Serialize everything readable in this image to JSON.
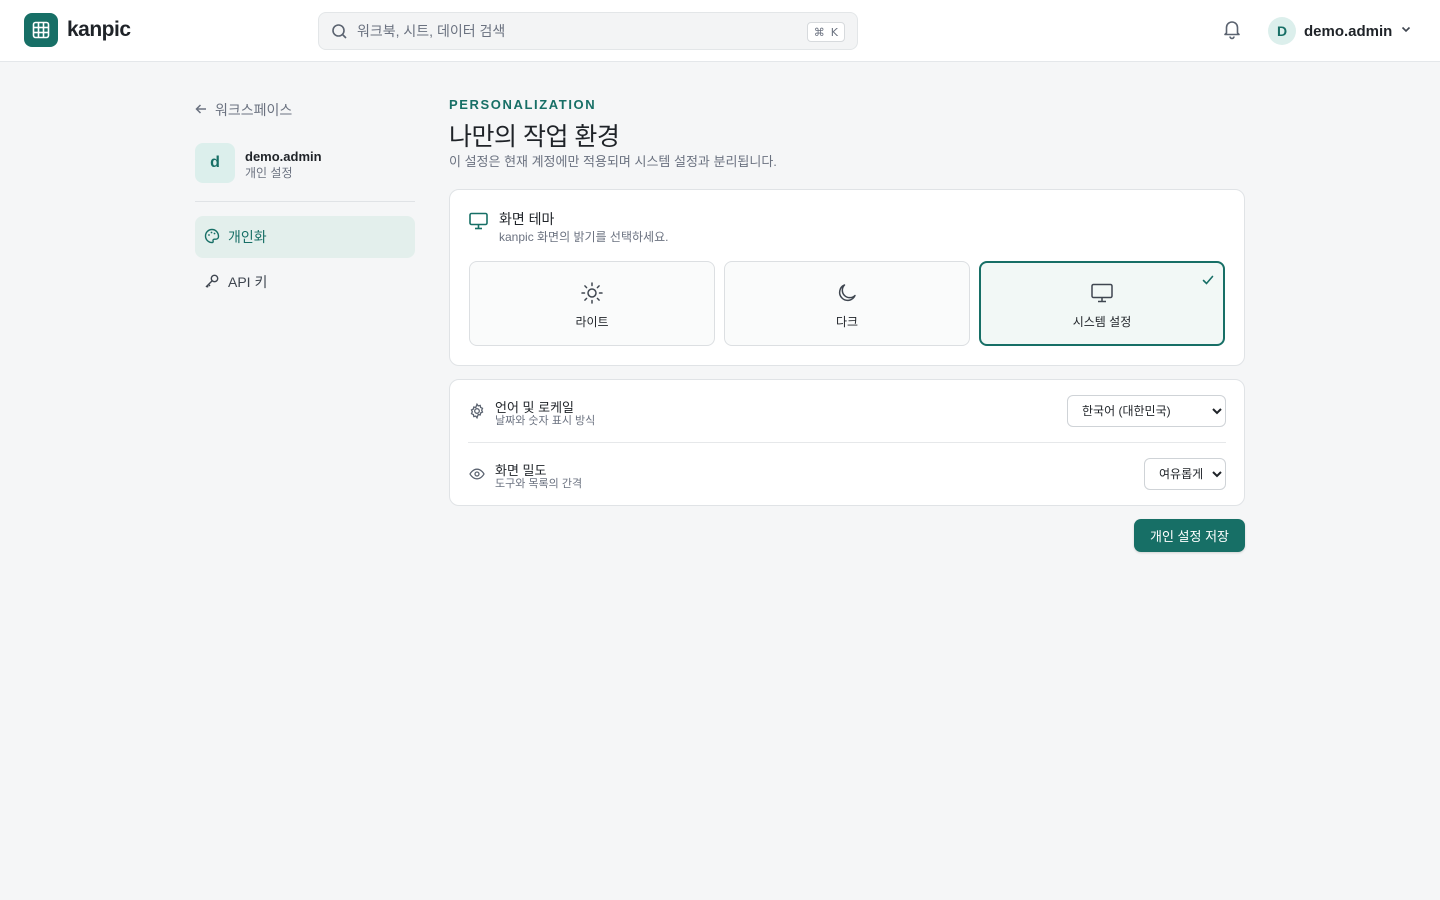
{
  "header": {
    "logo_text": "kanpic",
    "search_placeholder": "워크북, 시트, 데이터 검색",
    "shortcut_symbol": "⌘",
    "shortcut_key": "K",
    "user_initial": "D",
    "user_name": "demo.admin"
  },
  "sidebar": {
    "back_label": "워크스페이스",
    "profile_initial": "d",
    "profile_name": "demo.admin",
    "profile_subtitle": "개인 설정",
    "items": [
      {
        "label": "개인화",
        "icon": "palette-icon",
        "active": true
      },
      {
        "label": "API 키",
        "icon": "key-icon",
        "active": false
      }
    ]
  },
  "main": {
    "eyebrow": "PERSONALIZATION",
    "title": "나만의 작업 환경",
    "description": "이 설정은 현재 계정에만 적용되며 시스템 설정과 분리됩니다.",
    "theme": {
      "title": "화면 테마",
      "subtitle": "kanpic 화면의 밝기를 선택하세요.",
      "options": [
        {
          "label": "라이트",
          "icon": "sun-icon",
          "selected": false
        },
        {
          "label": "다크",
          "icon": "moon-icon",
          "selected": false
        },
        {
          "label": "시스템 설정",
          "icon": "monitor-icon",
          "selected": true
        }
      ]
    },
    "locale": {
      "title": "언어 및 로케일",
      "subtitle": "날짜와 숫자 표시 방식",
      "value": "한국어 (대한민국)"
    },
    "density": {
      "title": "화면 밀도",
      "subtitle": "도구와 목록의 간격",
      "value": "여유롭게"
    },
    "save_label": "개인 설정 저장"
  },
  "colors": {
    "accent": "#176f66",
    "accent_soft": "#e3efec",
    "background": "#f5f6f7",
    "muted_text": "#6b7280"
  }
}
